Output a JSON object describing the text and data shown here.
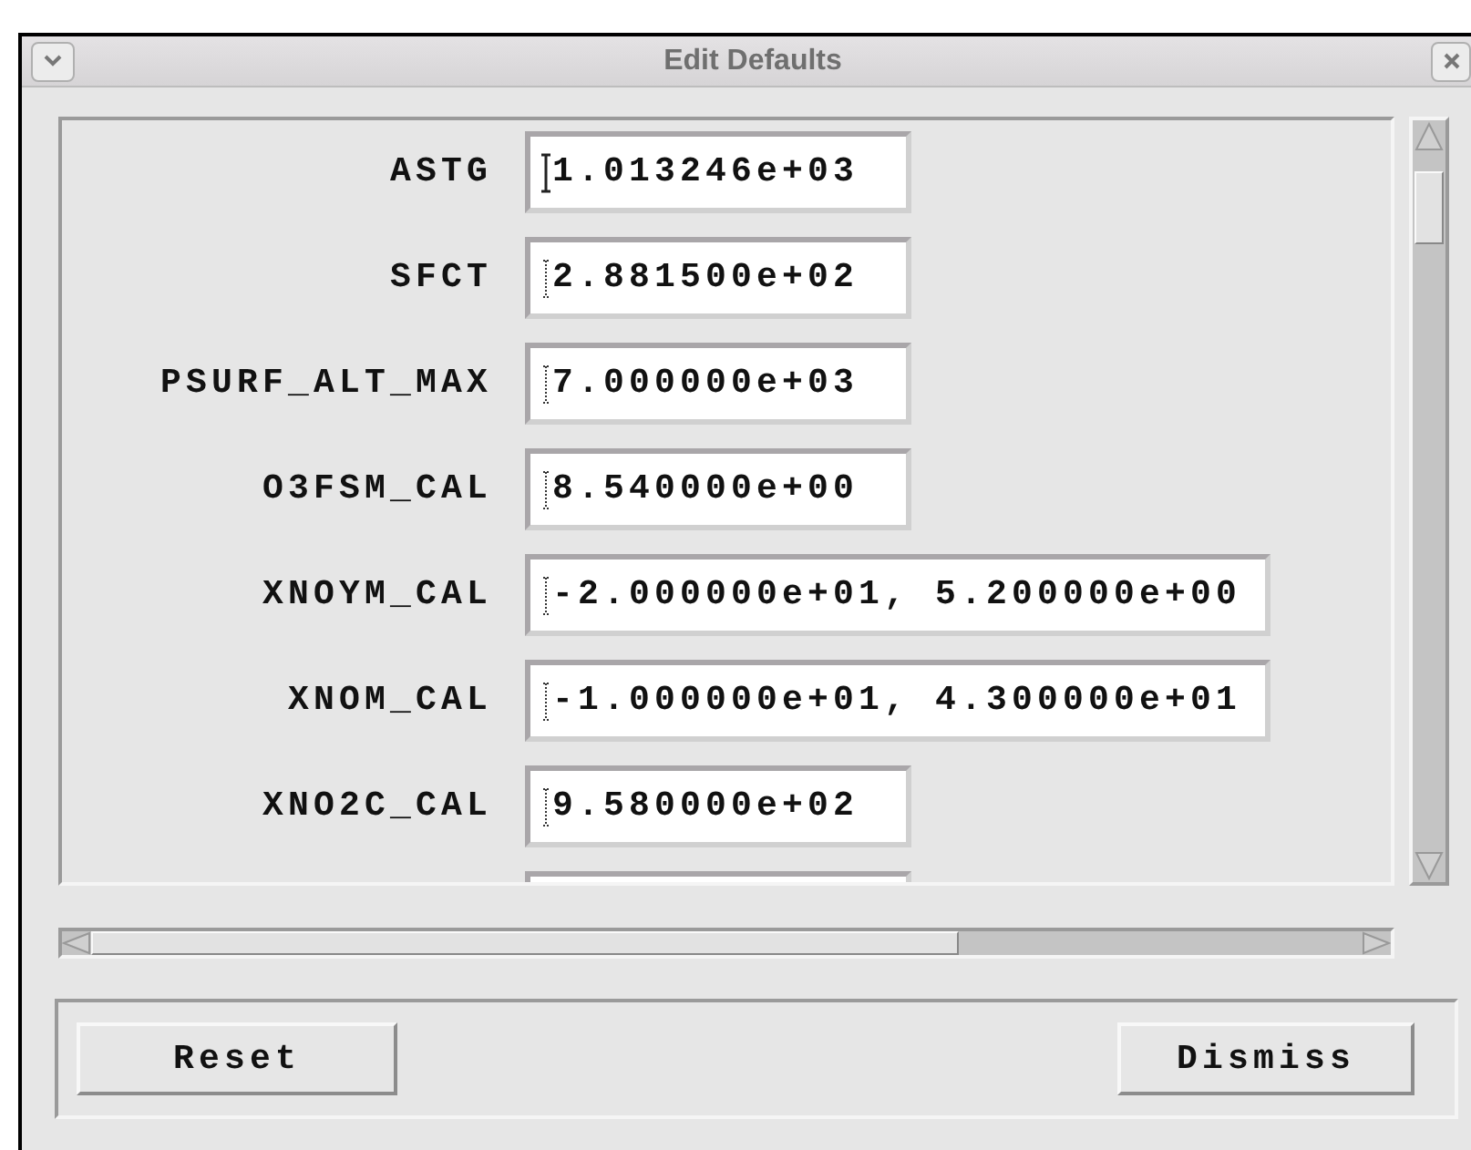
{
  "window": {
    "title": "Edit Defaults"
  },
  "fields": [
    {
      "kind": "field",
      "label": "ASTG",
      "value": "1.013246e+03",
      "focused": true
    },
    {
      "kind": "field",
      "label": "SFCT",
      "value": "2.881500e+02",
      "focused": false
    },
    {
      "kind": "field",
      "label": "PSURF_ALT_MAX",
      "value": "7.000000e+03",
      "focused": false
    },
    {
      "kind": "field",
      "label": "O3FSM_CAL",
      "value": "8.540000e+00",
      "focused": false
    },
    {
      "kind": "field",
      "label": "XNOYM_CAL",
      "value": "-2.000000e+01, 5.200000e+00",
      "focused": false
    },
    {
      "kind": "field",
      "label": "XNOM_CAL",
      "value": "-1.000000e+01, 4.300000e+01",
      "focused": false
    },
    {
      "kind": "field",
      "label": "XNO2C_CAL",
      "value": "9.580000e+02",
      "focused": false
    },
    {
      "kind": "cut-off"
    }
  ],
  "buttons": [
    "Reset",
    "Dismiss"
  ]
}
